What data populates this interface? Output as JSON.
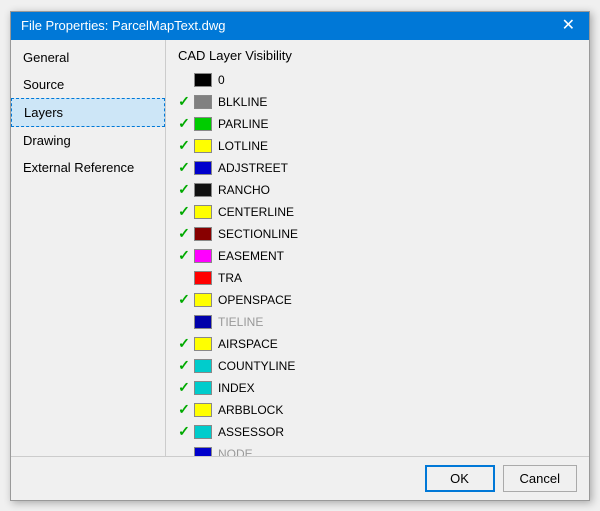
{
  "dialog": {
    "title": "File Properties: ParcelMapText.dwg",
    "close_label": "✕"
  },
  "sidebar": {
    "items": [
      {
        "id": "general",
        "label": "General",
        "active": false
      },
      {
        "id": "source",
        "label": "Source",
        "active": false
      },
      {
        "id": "layers",
        "label": "Layers",
        "active": true
      },
      {
        "id": "drawing",
        "label": "Drawing",
        "active": false
      },
      {
        "id": "external-reference",
        "label": "External Reference",
        "active": false
      }
    ]
  },
  "content": {
    "header": "CAD Layer Visibility",
    "layers": [
      {
        "name": "0",
        "color": "#000000",
        "checked": false,
        "enabled": true
      },
      {
        "name": "BLKLINE",
        "color": "#808080",
        "checked": true,
        "enabled": true
      },
      {
        "name": "PARLINE",
        "color": "#00cc00",
        "checked": true,
        "enabled": true
      },
      {
        "name": "LOTLINE",
        "color": "#ffff00",
        "checked": true,
        "enabled": true
      },
      {
        "name": "ADJSTREET",
        "color": "#0000cc",
        "checked": true,
        "enabled": true
      },
      {
        "name": "RANCHO",
        "color": "#111111",
        "checked": true,
        "enabled": true
      },
      {
        "name": "CENTERLINE",
        "color": "#ffff00",
        "checked": true,
        "enabled": true
      },
      {
        "name": "SECTIONLINE",
        "color": "#880000",
        "checked": true,
        "enabled": true
      },
      {
        "name": "EASEMENT",
        "color": "#ff00ff",
        "checked": true,
        "enabled": true
      },
      {
        "name": "TRA",
        "color": "#ff0000",
        "checked": false,
        "enabled": true
      },
      {
        "name": "OPENSPACE",
        "color": "#ffff00",
        "checked": true,
        "enabled": true
      },
      {
        "name": "TIELINE",
        "color": "#0000aa",
        "checked": false,
        "enabled": false
      },
      {
        "name": "AIRSPACE",
        "color": "#ffff00",
        "checked": true,
        "enabled": true
      },
      {
        "name": "COUNTYLINE",
        "color": "#00cccc",
        "checked": true,
        "enabled": true
      },
      {
        "name": "INDEX",
        "color": "#00cccc",
        "checked": true,
        "enabled": true
      },
      {
        "name": "ARBBLOCK",
        "color": "#ffff00",
        "checked": true,
        "enabled": true
      },
      {
        "name": "ASSESSOR",
        "color": "#00cccc",
        "checked": true,
        "enabled": true
      },
      {
        "name": "NODE",
        "color": "#0000cc",
        "checked": false,
        "enabled": false
      }
    ]
  },
  "footer": {
    "ok_label": "OK",
    "cancel_label": "Cancel"
  }
}
